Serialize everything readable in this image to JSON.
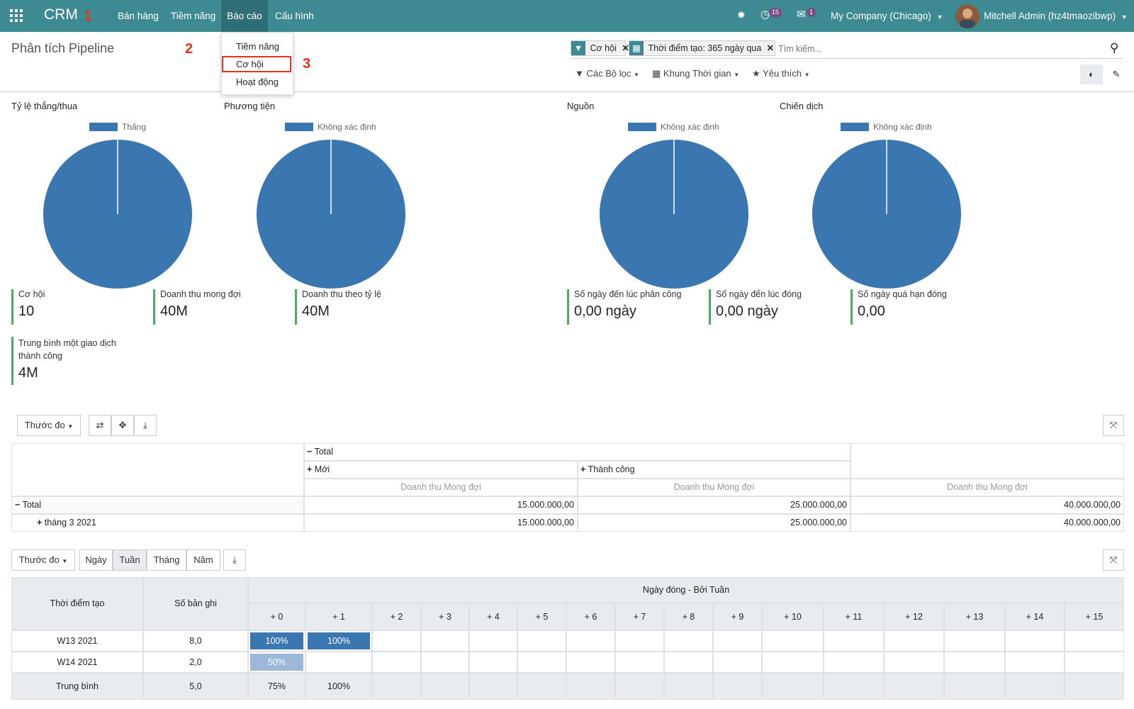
{
  "navbar": {
    "app_name": "CRM",
    "annot_1": "1",
    "menu": [
      "Bán hàng",
      "Tiềm năng",
      "Báo cáo",
      "Cấu hình"
    ],
    "activity_count": "15",
    "message_count": "1",
    "company": "My Company (Chicago)",
    "user": "Mitchell Admin (hz4tmaozibwp)",
    "accent": "#3d8a92"
  },
  "annotations": {
    "a2": "2",
    "a3": "3"
  },
  "dropdown": {
    "items": [
      "Tiềm năng",
      "Cơ hội",
      "Hoạt động"
    ]
  },
  "page_title": "Phân tích Pipeline",
  "search": {
    "facets": [
      "Cơ hội",
      "Thời điểm tạo: 365 ngày qua"
    ],
    "placeholder": "Tìm kiếm...",
    "filters": "Các Bộ lọc",
    "time": "Khung Thời gian",
    "favorites": "Yêu thích"
  },
  "charts": [
    {
      "title": "Tỷ lệ thắng/thua",
      "legend": "Thắng"
    },
    {
      "title": "Phương tiện",
      "legend": "Không xác định"
    },
    {
      "title": "Nguồn",
      "legend": "Không xác định"
    },
    {
      "title": "Chiến dịch",
      "legend": "Không xác định"
    }
  ],
  "kpis": [
    {
      "label": "Cơ hội",
      "value": "10"
    },
    {
      "label": "Doanh thu mong đợi",
      "value": "40M"
    },
    {
      "label": "Doanh thu theo tỷ lệ",
      "value": "40M"
    },
    {
      "label": "Số ngày đến lúc phân công",
      "value": "0,00 ngày"
    },
    {
      "label": "Số ngày đến lúc đóng",
      "value": "0,00 ngày"
    },
    {
      "label": "Số ngày quá hạn đóng",
      "value": "0,00"
    },
    {
      "label": "Trung bình một giao dịch thành công",
      "value": "4M"
    }
  ],
  "pivot": {
    "measure_btn": "Thước đo",
    "col_total": "Total",
    "col_groups": [
      "Mới",
      "Thành công"
    ],
    "measure": "Doanh thu Mong đợi",
    "rows": [
      {
        "label": "Total",
        "values": [
          "15.000.000,00",
          "25.000.000,00",
          "40.000.000,00"
        ]
      },
      {
        "label": "tháng 3 2021",
        "values": [
          "15.000.000,00",
          "25.000.000,00",
          "40.000.000,00"
        ]
      }
    ]
  },
  "cohort": {
    "measure_btn": "Thước đo",
    "intervals": [
      "Ngày",
      "Tuần",
      "Tháng",
      "Năm"
    ],
    "col_date": "Thời điểm tạo",
    "col_count": "Số bản ghi",
    "group_header": "Ngày đóng - Bởi Tuần",
    "periods": [
      "+ 0",
      "+ 1",
      "+ 2",
      "+ 3",
      "+ 4",
      "+ 5",
      "+ 6",
      "+ 7",
      "+ 8",
      "+ 9",
      "+ 10",
      "+ 11",
      "+ 12",
      "+ 13",
      "+ 14",
      "+ 15"
    ],
    "rows": [
      {
        "label": "W13 2021",
        "count": "8,0",
        "cells": [
          "100%",
          "100%"
        ]
      },
      {
        "label": "W14 2021",
        "count": "2,0",
        "cells": [
          "50%"
        ]
      }
    ],
    "average": {
      "label": "Trung bình",
      "count": "5,0",
      "cells": [
        "75%",
        "100%"
      ]
    }
  }
}
